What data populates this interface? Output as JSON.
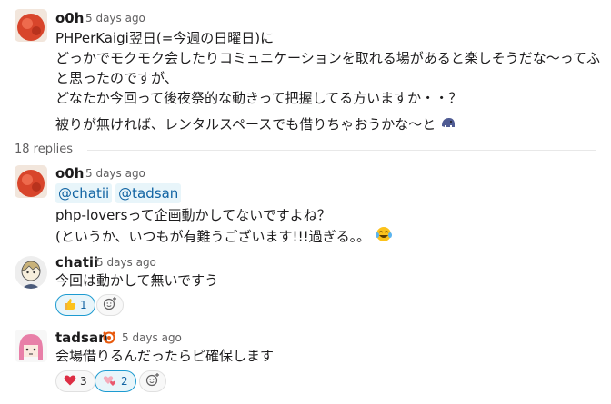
{
  "parent": {
    "author": "o0h",
    "time": "5 days ago",
    "lines": [
      "PHPerKaigi翌日(=今週の日曜日)に",
      "どっかでモクモク会したりコミュニケーションを取れる場があると楽しそうだな〜ってふ",
      "と思ったのですが、",
      "どなたか今回って後夜祭的な動きって把握してる方いますか・・？"
    ],
    "last_line": "被りが無ければ、レンタルスペースでも借りちゃおうかな〜と"
  },
  "replies_count": "18 replies",
  "thread": [
    {
      "author": "o0h",
      "time": "5 days ago",
      "mentions": [
        "@chatii",
        "@tadsan"
      ],
      "lines": [
        "php-loversって企画動かしてないですよね？",
        "(というか、いつもが有難うございます!!!過ぎる。。"
      ]
    },
    {
      "author": "chatii",
      "time": "5 days ago",
      "text": "今回は動かして無いですう",
      "reactions": [
        {
          "emoji": "thumbs-up",
          "count": "1"
        }
      ]
    },
    {
      "author": "tadsan",
      "time": "5 days ago",
      "text": "会場借りるんだったらピ確保します",
      "reactions": [
        {
          "emoji": "red-heart",
          "count": "3"
        },
        {
          "emoji": "two-hearts",
          "count": "2"
        }
      ]
    }
  ]
}
